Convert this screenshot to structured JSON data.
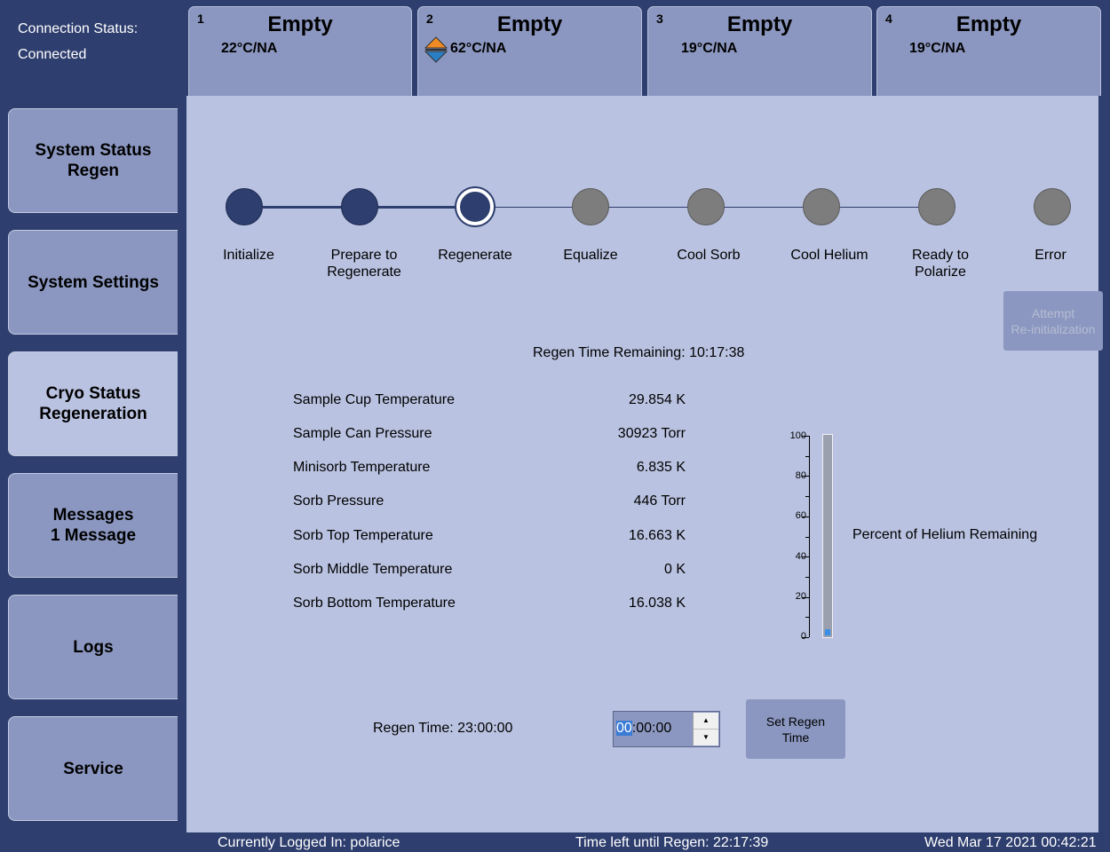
{
  "connection": {
    "label": "Connection Status:",
    "value": "Connected"
  },
  "slots": [
    {
      "num": "1",
      "title": "Empty",
      "temp": "22°C/NA"
    },
    {
      "num": "2",
      "title": "Empty",
      "temp": "62°C/NA"
    },
    {
      "num": "3",
      "title": "Empty",
      "temp": "19°C/NA"
    },
    {
      "num": "4",
      "title": "Empty",
      "temp": "19°C/NA"
    }
  ],
  "nav": [
    {
      "line1": "System Status",
      "line2": "Regen"
    },
    {
      "line1": "System Settings",
      "line2": ""
    },
    {
      "line1": "Cryo Status",
      "line2": "Regeneration"
    },
    {
      "line1": "Messages",
      "line2": "1 Message"
    },
    {
      "line1": "Logs",
      "line2": ""
    },
    {
      "line1": "Service",
      "line2": ""
    }
  ],
  "steps": [
    {
      "line1": "Initialize",
      "line2": "",
      "state": "done"
    },
    {
      "line1": "Prepare to",
      "line2": "Regenerate",
      "state": "done"
    },
    {
      "line1": "Regenerate",
      "line2": "",
      "state": "current"
    },
    {
      "line1": "Equalize",
      "line2": "",
      "state": "pending"
    },
    {
      "line1": "Cool Sorb",
      "line2": "",
      "state": "pending"
    },
    {
      "line1": "Cool Helium",
      "line2": "",
      "state": "pending"
    },
    {
      "line1": "Ready to",
      "line2": "Polarize",
      "state": "pending"
    },
    {
      "line1": "Error",
      "line2": "",
      "state": "pending"
    }
  ],
  "reinit_button": {
    "line1": "Attempt",
    "line2": "Re-initialization"
  },
  "regen_remaining": "Regen Time Remaining: 10:17:38",
  "readings": [
    {
      "label": "Sample Cup Temperature",
      "value": "29.854 K"
    },
    {
      "label": "Sample Can Pressure",
      "value": "30923 Torr"
    },
    {
      "label": "Minisorb Temperature",
      "value": "6.835 K"
    },
    {
      "label": "Sorb Pressure",
      "value": "446 Torr"
    },
    {
      "label": "Sorb Top Temperature",
      "value": "16.663 K"
    },
    {
      "label": "Sorb Middle Temperature",
      "value": "0 K"
    },
    {
      "label": "Sorb Bottom Temperature",
      "value": "16.038 K"
    }
  ],
  "helium_gauge": {
    "label": "Percent of Helium Remaining",
    "ticks": [
      "100",
      "80",
      "60",
      "40",
      "20",
      "0"
    ],
    "value_percent": 2,
    "fill_color": "#3b8ee8"
  },
  "regen_time": {
    "label": "Regen Time: 23:00:00",
    "input_selected": "00",
    "input_rest": ":00:00",
    "up_icon": "▲",
    "down_icon": "▼"
  },
  "set_button": {
    "line1": "Set Regen",
    "line2": "Time"
  },
  "statusbar": {
    "user": "Currently Logged In: polarice",
    "time_left": "Time left until Regen: 22:17:39",
    "datetime": "Wed Mar 17 2021 00:42:21"
  },
  "colors": {
    "background": "#2e3e6e",
    "panel": "#b9c2e0",
    "button": "#8b97c0"
  }
}
